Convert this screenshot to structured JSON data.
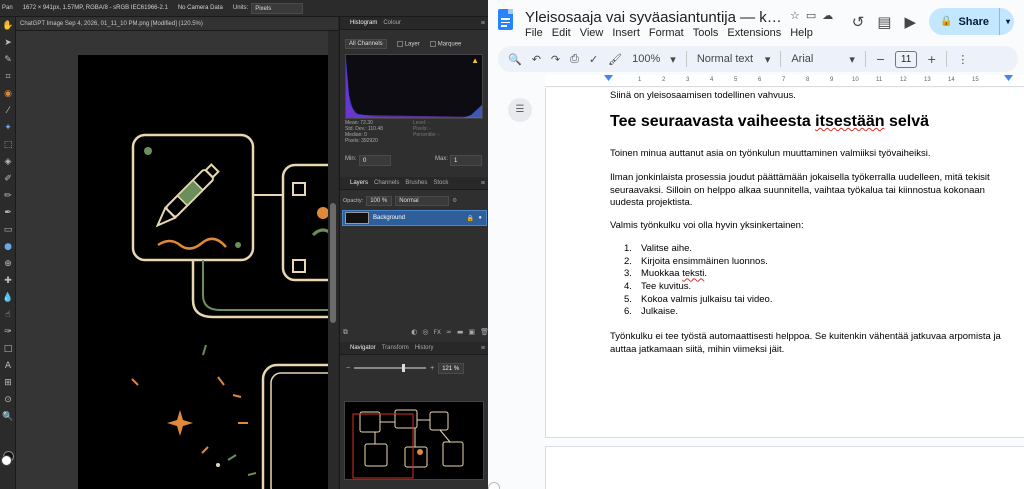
{
  "editor": {
    "context_bar": {
      "tool_label": "Pan",
      "doc_info": "1672 × 941px, 1.57MP, RGBA/8 - sRGB IEC61966-2.1",
      "camera": "No Camera Data",
      "units_label": "Units:",
      "units_value": "Pixels"
    },
    "doc_tab": "ChatGPT Image Sep 4, 2026, 01_11_10 PM.png [Modified] (120.5%)",
    "histogram": {
      "tabs": [
        "Histogram",
        "Colour"
      ],
      "channel": "All Channels",
      "layer_label": "Layer",
      "marquee_label": "Marquee",
      "stats_left": [
        "Mean: 72.30",
        "Std. Dev.: 110.48",
        "Median: 0",
        "Pixels: 392920"
      ],
      "stats_right": [
        "Level: -",
        "Pixels: -",
        "Percentile: -"
      ],
      "min_label": "Min:",
      "min_value": "0",
      "max_label": "Max:",
      "max_value": "1"
    },
    "layers": {
      "tabs": [
        "Layers",
        "Channels",
        "Brushes",
        "Stock"
      ],
      "opacity_label": "Opacity:",
      "opacity_value": "100 %",
      "blend_mode": "Normal",
      "layer_name": "Background"
    },
    "navigator": {
      "tabs": [
        "Navigator",
        "Transform",
        "History"
      ],
      "zoom_value": "121 %",
      "zoom_level": 0.67
    }
  },
  "docs": {
    "title": "Yleisosaaja vai syväasiantuntija — kumpi oppimis...",
    "menu": [
      "File",
      "Edit",
      "View",
      "Insert",
      "Format",
      "Tools",
      "Extensions",
      "Help"
    ],
    "share_label": "Share",
    "toolbar": {
      "zoom": "100%",
      "style": "Normal text",
      "font": "Arial",
      "font_size": "11"
    },
    "ruler_numbers": [
      "1",
      "2",
      "3",
      "4",
      "5",
      "6",
      "7",
      "8",
      "9",
      "10",
      "11",
      "12",
      "13",
      "14",
      "15"
    ],
    "content": {
      "top_line": "Siinä on yleisosaamisen todellinen vahvuus.",
      "heading_before": "Tee seuraavasta vaiheesta ",
      "heading_marked": "itsestään",
      "heading_after": " selvä",
      "para1": "Toinen minua auttanut asia on työnkulun muuttaminen valmiiksi työvaiheiksi.",
      "para2": "Ilman jonkinlaista prosessia joudut päättämään jokaisella työkerralla uudelleen, mitä tekisit seuraavaksi. Silloin on helppo alkaa suunnitella, vaihtaa työkalua tai kiinnostua kokonaan uudesta projektista.",
      "para3": "Valmis työnkulku voi olla hyvin yksinkertainen:",
      "steps": [
        {
          "num": "1.",
          "text": "Valitse aihe."
        },
        {
          "num": "2.",
          "text": "Kirjoita ensimmäinen luonnos."
        },
        {
          "num": "3.",
          "text": "Muokkaa ",
          "marked": "teksti",
          "after": "."
        },
        {
          "num": "4.",
          "text": "Tee kuvitus."
        },
        {
          "num": "5.",
          "text": "Kokoa valmis julkaisu tai video."
        },
        {
          "num": "6.",
          "text": "Julkaise."
        }
      ],
      "para4": "Työnkulku ei tee työstä automaattisesti helppoa. Se kuitenkin vähentää jatkuvaa arpomista ja auttaa jatkamaan siitä, mihin viimeksi jäit."
    }
  },
  "colors": {
    "editor_bg": "#262626",
    "layer_selected": "#2f5f9a",
    "docs_accent": "#c2e7ff",
    "spell_underline": "#d93025",
    "art_line": "#e8d7b0",
    "art_orange": "#e0893a",
    "art_green": "#6b8f5a"
  }
}
